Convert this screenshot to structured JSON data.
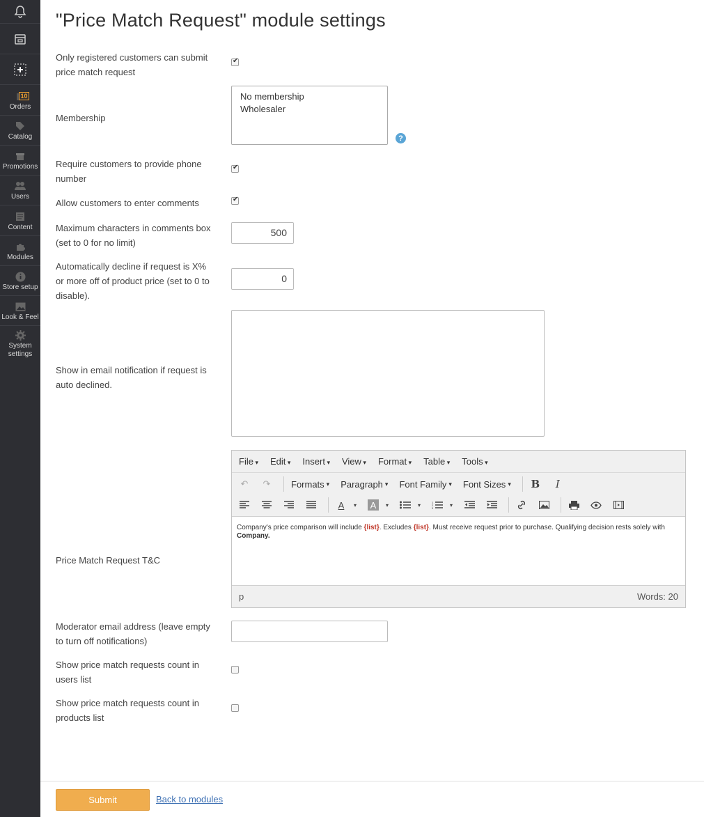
{
  "sidebar": {
    "top_icons": [
      "bell-icon",
      "store-icon",
      "add-icon"
    ],
    "items": [
      {
        "label": "Orders",
        "icon": "orders-icon",
        "badge": "10"
      },
      {
        "label": "Catalog",
        "icon": "tag-icon"
      },
      {
        "label": "Promotions",
        "icon": "gift-icon"
      },
      {
        "label": "Users",
        "icon": "users-icon"
      },
      {
        "label": "Content",
        "icon": "content-icon"
      },
      {
        "label": "Modules",
        "icon": "puzzle-icon"
      },
      {
        "label": "Store setup",
        "icon": "info-icon"
      },
      {
        "label": "Look & Feel",
        "icon": "image-icon"
      },
      {
        "label": "System settings",
        "icon": "gear-icon"
      }
    ]
  },
  "page": {
    "title": "\"Price Match Request\" module settings"
  },
  "form": {
    "registered_only": {
      "label": "Only registered customers can submit price match request",
      "checked": true
    },
    "membership": {
      "label": "Membership",
      "options": [
        "No membership",
        "Wholesaler"
      ]
    },
    "require_phone": {
      "label": "Require customers to provide phone number",
      "checked": true
    },
    "allow_comments": {
      "label": "Allow customers to enter comments",
      "checked": true
    },
    "max_chars": {
      "label": "Maximum characters in comments box (set to 0 for no limit)",
      "value": "500"
    },
    "auto_decline": {
      "label": "Automatically decline if request is X% or more off of product price (set to 0 to disable).",
      "value": "0"
    },
    "email_notification": {
      "label": "Show in email notification if request is auto declined.",
      "value": ""
    },
    "tc": {
      "label": "Price Match Request T&C",
      "menus": [
        "File",
        "Edit",
        "Insert",
        "View",
        "Format",
        "Table",
        "Tools"
      ],
      "dropdowns": [
        "Formats",
        "Paragraph",
        "Font Family",
        "Font Sizes"
      ],
      "content": {
        "p1": "Company's price comparison will include ",
        "r1": "{list}",
        "p2": ". Excludes ",
        "r2": "{list}",
        "p3": ".  Must receive request prior to purchase. Qualifying decision rests solely with ",
        "b1": "Company",
        "p4": "."
      },
      "status_path": "p",
      "word_count": "Words: 20"
    },
    "moderator_email": {
      "label": "Moderator email address (leave empty to turn off notifications)",
      "value": ""
    },
    "count_users": {
      "label": "Show price match requests count in users list",
      "checked": false
    },
    "count_products": {
      "label": "Show price match requests count in products list",
      "checked": false
    }
  },
  "footer": {
    "submit": "Submit",
    "back": "Back to modules"
  },
  "colors": {
    "sidebar_bg": "#2d2e33",
    "submit_bg": "#f0ad4e",
    "badge": "#f0a030",
    "link": "#3c6fb3"
  }
}
